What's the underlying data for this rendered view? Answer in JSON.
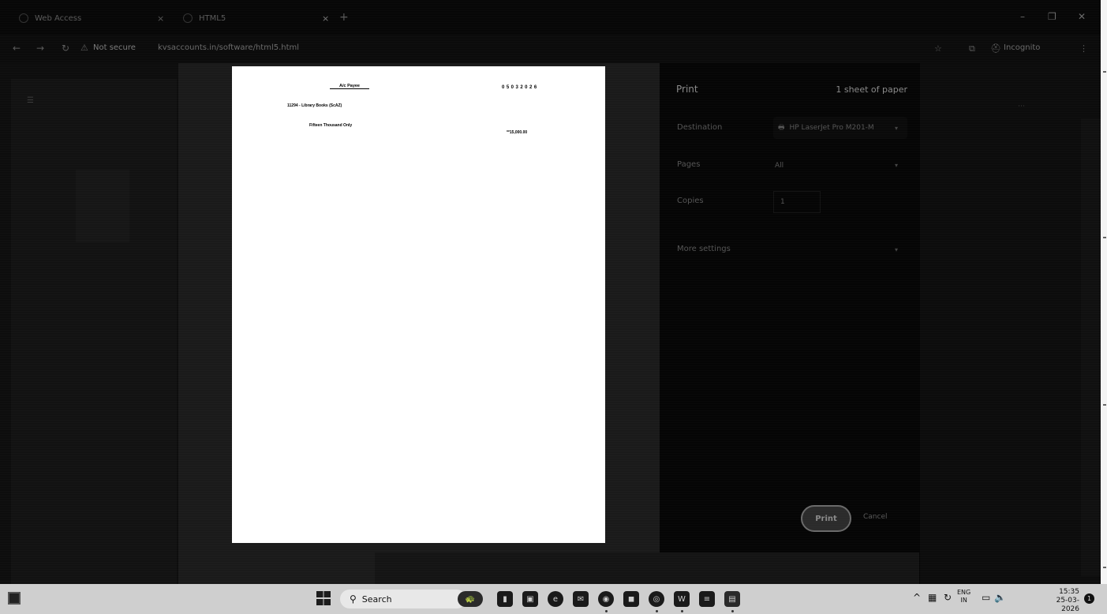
{
  "browser": {
    "tabs": [
      {
        "label": "Web Access"
      },
      {
        "label": "HTML5"
      }
    ],
    "tab_close": "×",
    "new_tab": "+",
    "security_label": "Not secure",
    "url": "kvsaccounts.in/software/html5.html",
    "incognito_label": "Incognito",
    "window_controls": {
      "minimize": "–",
      "restore": "❐",
      "close": "✕"
    }
  },
  "print_dialog": {
    "title": "Print",
    "sheet_count": "1 sheet of paper",
    "destination": {
      "label": "Destination",
      "value": "HP LaserJet Pro M201-M"
    },
    "pages": {
      "label": "Pages",
      "value": "All"
    },
    "copies": {
      "label": "Copies",
      "value": "1"
    },
    "more_settings": {
      "label": "More settings"
    },
    "print_button": "Print",
    "cancel_button": "Cancel"
  },
  "preview": {
    "payee_line": "A/c Payee",
    "date": "05032026",
    "account": "11294 - Library Books (ScAZ)",
    "amount_words": "Fifteen Thousand Only",
    "amount": "**15,000.00"
  },
  "taskbar": {
    "search_placeholder": "Search",
    "language_top": "ENG",
    "language_bottom": "IN",
    "time": "15:35",
    "date": "25-03-2026",
    "notification_count": "1"
  }
}
